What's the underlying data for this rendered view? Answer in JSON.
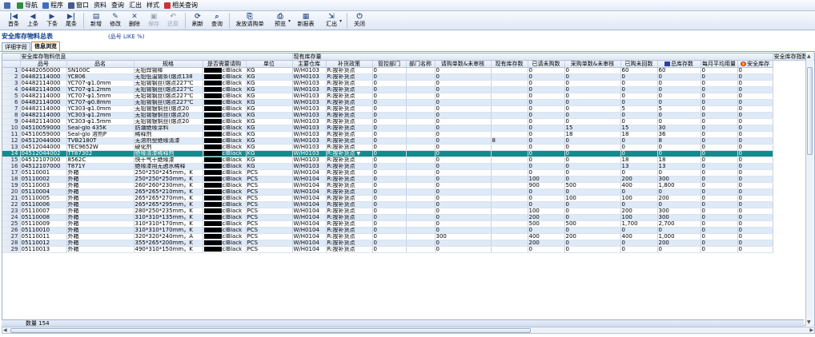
{
  "menu": [
    {
      "label": "",
      "icon": "app-menu-icon"
    },
    {
      "label": "导航",
      "icon": "navigate-icon"
    },
    {
      "label": "程序",
      "icon": "program-icon"
    },
    {
      "label": "窗口",
      "icon": "window-icon"
    },
    {
      "label": "资料",
      "icon": ""
    },
    {
      "label": "查询",
      "icon": ""
    },
    {
      "label": "汇出",
      "icon": ""
    },
    {
      "label": "样式",
      "icon": ""
    },
    {
      "label": "相关查询",
      "icon": "related-query-icon"
    }
  ],
  "toolbar": [
    {
      "label": "首条",
      "icon": "first-record-icon",
      "glyph": "|◀",
      "disabled": false,
      "w": ""
    },
    {
      "label": "上条",
      "icon": "prev-record-icon",
      "glyph": "◀",
      "disabled": false,
      "w": ""
    },
    {
      "label": "下条",
      "icon": "next-record-icon",
      "glyph": "▶",
      "disabled": false,
      "w": ""
    },
    {
      "label": "尾条",
      "icon": "last-record-icon",
      "glyph": "▶|",
      "disabled": false,
      "w": ""
    },
    {
      "label": "新增",
      "icon": "new-icon",
      "glyph": "▤",
      "disabled": false,
      "w": ""
    },
    {
      "label": "修改",
      "icon": "edit-icon",
      "glyph": "✎",
      "disabled": false,
      "w": ""
    },
    {
      "label": "删除",
      "icon": "delete-icon",
      "glyph": "✕",
      "disabled": false,
      "w": ""
    },
    {
      "label": "保存",
      "icon": "save-icon",
      "glyph": "▣",
      "disabled": true,
      "w": ""
    },
    {
      "label": "还原",
      "icon": "undo-icon",
      "glyph": "↶",
      "disabled": true,
      "w": ""
    },
    {
      "label": "刷新",
      "icon": "refresh-icon",
      "glyph": "⟳",
      "disabled": false,
      "w": ""
    },
    {
      "label": "查询",
      "icon": "query-icon",
      "glyph": "⌕",
      "disabled": false,
      "w": ""
    },
    {
      "label": "发放请购单",
      "icon": "issue-requisition-icon",
      "glyph": "⎘",
      "disabled": false,
      "w": "wide"
    },
    {
      "label": "预览",
      "icon": "preview-icon",
      "glyph": "⎙",
      "disabled": false,
      "w": "mid",
      "drop": true
    },
    {
      "label": "新报表",
      "icon": "new-report-icon",
      "glyph": "▦",
      "disabled": false,
      "w": "mid"
    },
    {
      "label": "汇出",
      "icon": "export-icon",
      "glyph": "⇲",
      "disabled": false,
      "w": "mid",
      "drop": true
    },
    {
      "label": "关闭",
      "icon": "close-icon",
      "glyph": "⏻",
      "disabled": false,
      "w": ""
    }
  ],
  "form": {
    "title": "安全库存物料总表",
    "filter": "(品号 LIKE %)"
  },
  "tabs": [
    {
      "label": "详细字段",
      "active": false
    },
    {
      "label": "信息浏览",
      "active": true
    }
  ],
  "groups": [
    {
      "label": "安全库存物料信息",
      "span": 5
    },
    {
      "label": "现有库存量",
      "span": 12
    },
    {
      "label": "安全库存指数",
      "span": 3
    }
  ],
  "columns": [
    "",
    "品号",
    "品名",
    "规格",
    "是否需要请购",
    "单位",
    "主要仓库",
    "补货政策",
    "管控部门",
    "部门名称",
    "请购单数&未审核",
    "现有库存数",
    "已请未购数",
    "采购单数&未审核",
    "已购未回数",
    "总库存数",
    "每月平均用量",
    "安全库存"
  ],
  "rows": [
    [
      "1",
      "04482050000",
      "SN100C",
      "无铅焊锡棒",
      "clBlack",
      "KG",
      "W/H0103",
      "R:按补货点",
      "0",
      "",
      "0",
      "",
      "0",
      "0",
      "60",
      "60",
      "0",
      "0"
    ],
    [
      "2",
      "04482114000",
      "YC806",
      "无铅低温锡条(熔点138",
      "clBlack",
      "KG",
      "W/H0103",
      "R:按补货点",
      "0",
      "",
      "0",
      "",
      "0",
      "0",
      "0",
      "0",
      "0",
      "0"
    ],
    [
      "3",
      "04482114000",
      "YC707-φ1.0mm",
      "无铅锡钢丝(熔点227℃",
      "clBlack",
      "KG",
      "W/H0103",
      "R:按补货点",
      "0",
      "",
      "0",
      "",
      "0",
      "0",
      "0",
      "0",
      "0",
      "0"
    ],
    [
      "4",
      "04482114000",
      "YC707-φ1.2mm",
      "无铅锡钢丝(熔点227℃",
      "clBlack",
      "KG",
      "W/H0103",
      "R:按补货点",
      "0",
      "",
      "0",
      "",
      "0",
      "0",
      "0",
      "0",
      "0",
      "0"
    ],
    [
      "5",
      "04482114000",
      "YC707-φ1.5mm",
      "无铅锡钢丝(熔点227℃",
      "clBlack",
      "KG",
      "W/H0103",
      "R:按补货点",
      "0",
      "",
      "0",
      "",
      "0",
      "0",
      "0",
      "0",
      "0",
      "0"
    ],
    [
      "6",
      "04482114000",
      "YC707-φ0.8mm",
      "无铅锡钢丝(熔点227℃",
      "clBlack",
      "KG",
      "W/H0103",
      "R:按补货点",
      "0",
      "",
      "0",
      "",
      "0",
      "0",
      "0",
      "0",
      "0",
      "0"
    ],
    [
      "7",
      "04482114000",
      "YC303-φ1.0mm",
      "无铅锡银铜丝(熔点20",
      "clBlack",
      "KG",
      "W/H0103",
      "R:按补货点",
      "0",
      "",
      "0",
      "",
      "0",
      "0",
      "5",
      "5",
      "0",
      "0"
    ],
    [
      "8",
      "04482114000",
      "YC303-φ1.2mm",
      "无铅锡银铜丝(熔点20",
      "clBlack",
      "KG",
      "W/H0103",
      "R:按补货点",
      "0",
      "",
      "0",
      "",
      "0",
      "0",
      "0",
      "0",
      "0",
      "0"
    ],
    [
      "9",
      "04482114000",
      "YC303-φ1.5mm",
      "无铅锡银铜丝(熔点20",
      "clBlack",
      "KG",
      "W/H0103",
      "R:按补货点",
      "0",
      "",
      "0",
      "",
      "0",
      "0",
      "0",
      "0",
      "0",
      "0"
    ],
    [
      "10",
      "04510059000",
      "Seal-glo 435K",
      "防潮绝缘涂料",
      "clBlack",
      "KG",
      "W/H0103",
      "R:按补货点",
      "0",
      "",
      "0",
      "",
      "0",
      "15",
      "15",
      "30",
      "0",
      "0"
    ],
    [
      "11",
      "04510059000",
      "Seal-glo 溶剂P",
      "稀释剂",
      "clBlack",
      "KG",
      "W/H0103",
      "R:按补货点",
      "0",
      "",
      "0",
      "",
      "0",
      "18",
      "18",
      "36",
      "0",
      "0"
    ],
    [
      "12",
      "04512044000",
      "TVB2180T",
      "无溶剂型绝缘清漆",
      "clBlack",
      "KG",
      "W/H0103",
      "R:按补货点",
      "0",
      "",
      "0",
      "8",
      "0",
      "0",
      "0",
      "8",
      "0",
      "0"
    ],
    [
      "13",
      "04512044000",
      "TEC9652W",
      "硬化剂",
      "clBlack",
      "KG",
      "W/H0103",
      "R:按补货点",
      "0",
      "",
      "0",
      "",
      "0",
      "0",
      "0",
      "0",
      "0",
      "0"
    ],
    [
      "14",
      "04512044002",
      "TT87302",
      "绝缘清漆稀释剂",
      "clBlack",
      "KG",
      "W/H0103",
      "R:按补货点",
      "0",
      "",
      "0",
      "",
      "0",
      "0",
      "0",
      "0",
      "0",
      "0"
    ],
    [
      "15",
      "04512107000",
      "8562C",
      "快干气干绝缘漆",
      "clBlack",
      "KG",
      "W/H0103",
      "R:按补货点",
      "0",
      "",
      "0",
      "",
      "0",
      "0",
      "18",
      "18",
      "0",
      "0"
    ],
    [
      "16",
      "04512107000",
      "T871Y",
      "绝缘漆用无卤水稀释",
      "clBlack",
      "KG",
      "W/H0103",
      "R:按补货点",
      "0",
      "",
      "0",
      "",
      "0",
      "0",
      "13",
      "13",
      "0",
      "0"
    ],
    [
      "17",
      "05110001",
      "外箱",
      "250*250*245mm，K",
      "clBlack",
      "PCS",
      "W/H0104",
      "R:按补货点",
      "0",
      "",
      "0",
      "",
      "0",
      "0",
      "0",
      "0",
      "0",
      "0"
    ],
    [
      "18",
      "05110002",
      "外箱",
      "250*250*250mm，K",
      "clBlack",
      "PCS",
      "W/H0104",
      "R:按补货点",
      "0",
      "",
      "0",
      "",
      "100",
      "0",
      "200",
      "300",
      "0",
      "0"
    ],
    [
      "19",
      "05110003",
      "外箱",
      "260*260*230mm，K",
      "clBlack",
      "PCS",
      "W/H0104",
      "R:按补货点",
      "0",
      "",
      "0",
      "",
      "900",
      "500",
      "400",
      "1,800",
      "0",
      "0"
    ],
    [
      "20",
      "05110004",
      "外箱",
      "265*265*210mm，K",
      "clBlack",
      "PCS",
      "W/H0104",
      "R:按补货点",
      "0",
      "",
      "0",
      "",
      "0",
      "0",
      "0",
      "0",
      "0",
      "0"
    ],
    [
      "21",
      "05110005",
      "外箱",
      "265*265*270mm，K",
      "clBlack",
      "PCS",
      "W/H0104",
      "R:按补货点",
      "0",
      "",
      "0",
      "",
      "0",
      "100",
      "100",
      "200",
      "0",
      "0"
    ],
    [
      "22",
      "05110006",
      "外箱",
      "265*265*295mm，K",
      "clBlack",
      "PCS",
      "W/H0104",
      "R:按补货点",
      "0",
      "",
      "0",
      "",
      "0",
      "0",
      "0",
      "0",
      "0",
      "0"
    ],
    [
      "23",
      "05110007",
      "外箱",
      "280*250*235mm，K",
      "clBlack",
      "PCS",
      "W/H0104",
      "R:按补货点",
      "0",
      "",
      "0",
      "",
      "100",
      "0",
      "200",
      "300",
      "0",
      "0"
    ],
    [
      "24",
      "05110008",
      "外箱",
      "310*310*135mm，K",
      "clBlack",
      "PCS",
      "W/H0104",
      "R:按补货点",
      "0",
      "",
      "0",
      "",
      "200",
      "0",
      "100",
      "300",
      "0",
      "0"
    ],
    [
      "25",
      "05110009",
      "外箱",
      "310*310*170mm，K",
      "clBlack",
      "PCS",
      "W/H0104",
      "R:按补货点",
      "0",
      "",
      "0",
      "",
      "500",
      "500",
      "1,700",
      "2,700",
      "0",
      "0"
    ],
    [
      "26",
      "05110010",
      "外箱",
      "310*310*170mm，K",
      "clBlack",
      "PCS",
      "W/H0104",
      "R:按补货点",
      "0",
      "",
      "0",
      "",
      "0",
      "0",
      "0",
      "0",
      "0",
      "0"
    ],
    [
      "27",
      "05110011",
      "外箱",
      "320*320*240mm，A",
      "clBlack",
      "PCS",
      "W/H0104",
      "R:按补货点",
      "0",
      "",
      "300",
      "",
      "400",
      "200",
      "400",
      "1,000",
      "0",
      "0"
    ],
    [
      "28",
      "05110012",
      "外箱",
      "355*265*200mm，K",
      "clBlack",
      "PCS",
      "W/H0104",
      "R:按补货点",
      "0",
      "",
      "0",
      "",
      "200",
      "0",
      "0",
      "200",
      "0",
      "0"
    ],
    [
      "29",
      "05110013",
      "外箱",
      "490*310*150mm，K",
      "clBlack",
      "PCS",
      "W/H0104",
      "R:按补货点",
      "0",
      "",
      "0",
      "",
      "0",
      "0",
      "0",
      "0",
      "0",
      "0"
    ]
  ],
  "selected_row": 13,
  "footer": {
    "count_label": "数量 154"
  }
}
